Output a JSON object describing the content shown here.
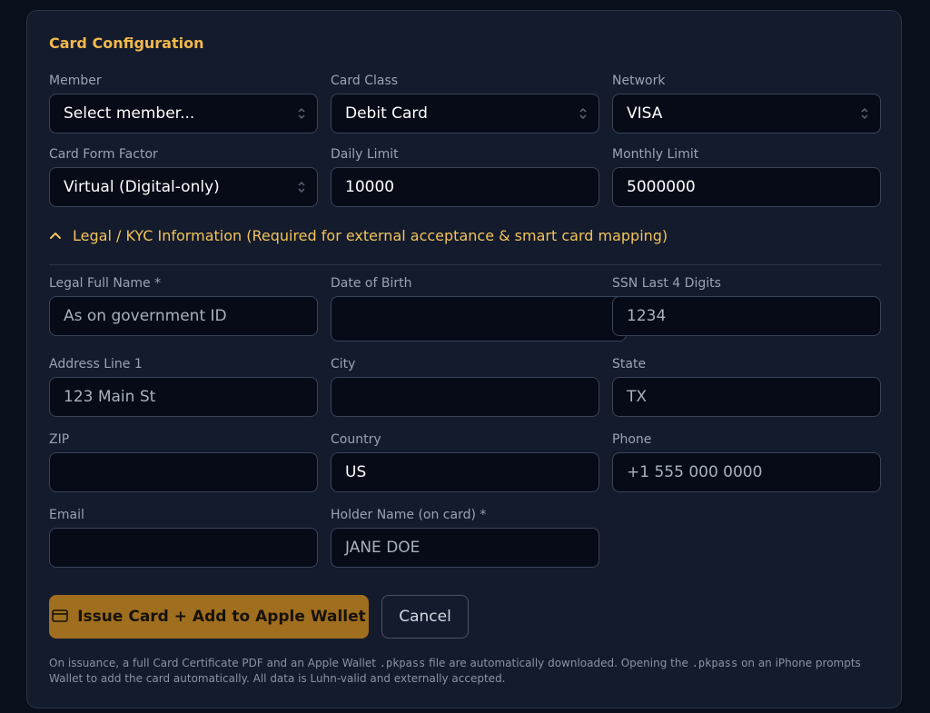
{
  "card_config": {
    "title": "Card Configuration",
    "member": {
      "label": "Member",
      "value": "Select member..."
    },
    "card_class": {
      "label": "Card Class",
      "value": "Debit Card"
    },
    "network": {
      "label": "Network",
      "value": "VISA"
    },
    "form_factor": {
      "label": "Card Form Factor",
      "value": "Virtual (Digital-only)"
    },
    "daily_limit": {
      "label": "Daily Limit",
      "value": "10000"
    },
    "monthly_limit": {
      "label": "Monthly Limit",
      "value": "5000000"
    }
  },
  "kyc": {
    "toggle_label": "Legal / KYC Information (Required for external acceptance & smart card mapping)",
    "legal_name": {
      "label": "Legal Full Name *",
      "value": "",
      "placeholder": "As on government ID"
    },
    "dob": {
      "label": "Date of Birth",
      "value": ""
    },
    "ssn": {
      "label": "SSN Last 4 Digits",
      "value": "",
      "placeholder": "1234"
    },
    "address1": {
      "label": "Address Line 1",
      "value": "",
      "placeholder": "123 Main St"
    },
    "city": {
      "label": "City",
      "value": ""
    },
    "state": {
      "label": "State",
      "value": "",
      "placeholder": "TX"
    },
    "zip": {
      "label": "ZIP",
      "value": ""
    },
    "country": {
      "label": "Country",
      "value": "US"
    },
    "phone": {
      "label": "Phone",
      "value": "",
      "placeholder": "+1 555 000 0000"
    },
    "email": {
      "label": "Email",
      "value": ""
    },
    "holder_name": {
      "label": "Holder Name (on card) *",
      "value": "",
      "placeholder": "JANE DOE"
    }
  },
  "actions": {
    "issue_label": "Issue Card + Add to Apple Wallet",
    "cancel_label": "Cancel"
  },
  "footnote": {
    "part1": "On issuance, a full Card Certificate PDF and an Apple Wallet ",
    "code1": ".pkpass",
    "part2": " file are automatically downloaded. Opening the ",
    "code2": ".pkpass",
    "part3": " on an iPhone prompts Wallet to add the card automatically. All data is Luhn-valid and externally accepted."
  },
  "colors": {
    "accent": "#f2b84b",
    "primary_button": "#a06e1f",
    "panel": "#141b2c",
    "input_bg": "#070b18"
  }
}
